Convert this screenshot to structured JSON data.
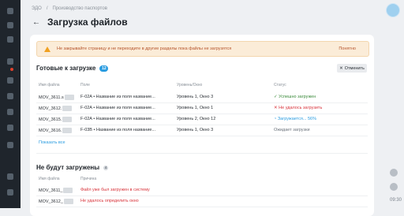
{
  "breadcrumb": {
    "home": "ЭДО",
    "separator": "/",
    "current": "Производство паспортов"
  },
  "page": {
    "title": "Загрузка файлов"
  },
  "warning": {
    "text": "Не закрывайте страницу и не переходите в другие разделы пока файлы не загрузятся",
    "action": "Понятно"
  },
  "ready": {
    "title": "Готовые к загрузке",
    "count": "12",
    "cancel_label": "Отменить",
    "headers": {
      "name": "Имя файла",
      "field": "Поле",
      "level": "Уровень/Окно",
      "status": "Статус"
    },
    "rows": [
      {
        "name": "MOV_3611.s",
        "field": "F-02A • Название из поля название...",
        "level": "Уровень 1, Окно 3",
        "status": "Успешно загружен",
        "status_icon": "✓",
        "kind": "ok"
      },
      {
        "name": "MOV_3612.",
        "field": "F-02A • Название из поля название...",
        "level": "Уровень 1, Окно 1",
        "status": "Не удалось загрузить",
        "status_icon": "✕",
        "kind": "err"
      },
      {
        "name": "MOV_3615.",
        "field": "F-02A • Название из поля название...",
        "level": "Уровень 2, Окно 12",
        "status": "Загружается... 56%",
        "status_icon": "◔",
        "kind": "run"
      },
      {
        "name": "MOV_3616.",
        "field": "F-03B • Название из поля название...",
        "level": "Уровень 1, Окно 3",
        "status": "Ожидает загрузки",
        "status_icon": "",
        "kind": "wait"
      }
    ],
    "show_all": "Показать все"
  },
  "skipped": {
    "title": "Не будут загружены",
    "count": "4",
    "headers": {
      "name": "Имя файла",
      "reason": "Причина"
    },
    "rows": [
      {
        "name": "MOV_3611_",
        "reason": "Файл уже был загружен в систему"
      },
      {
        "name": "MOV_3612_",
        "reason": "Не удалось определить окно"
      }
    ]
  },
  "clock": "09:30"
}
